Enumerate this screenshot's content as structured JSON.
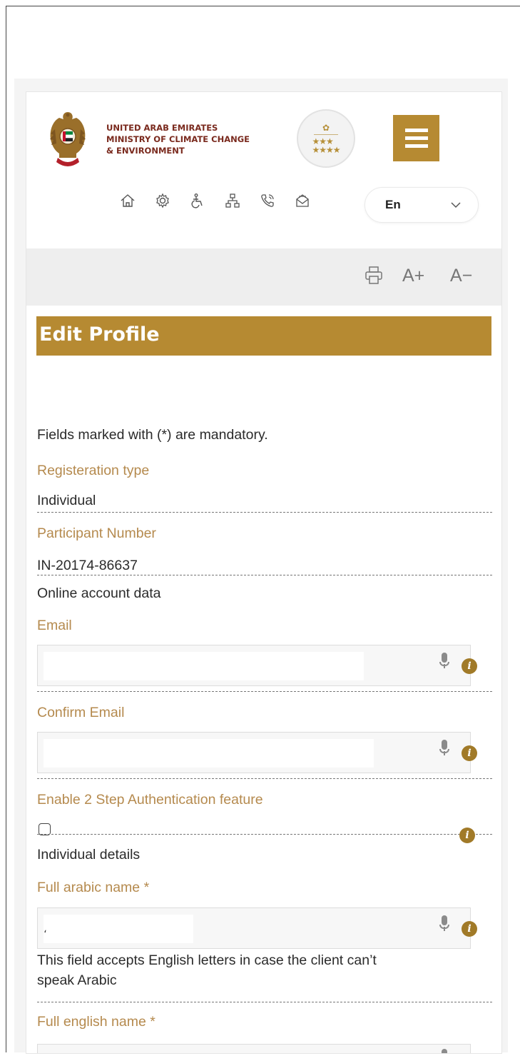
{
  "header": {
    "ministry_lines": [
      "UNITED ARAB EMIRATES",
      "MINISTRY OF CLIMATE CHANGE",
      "& ENVIRONMENT"
    ],
    "menu_icon": "hamburger-icon",
    "badge_icon": "seven-star-rating-badge"
  },
  "utility_icons": [
    "home-icon",
    "settings-icon",
    "accessibility-icon",
    "sitemap-icon",
    "phone-icon",
    "mail-icon"
  ],
  "language": {
    "selected": "En"
  },
  "toolbar": {
    "print_icon": "print-icon",
    "increase_font": "A+",
    "decrease_font": "A−"
  },
  "page": {
    "title": "Edit Profile"
  },
  "form": {
    "mandatory_note": "Fields marked with (*) are mandatory.",
    "registration_type_label": "Registeration type",
    "registration_type_value": "Individual",
    "participant_number_label": "Participant Number",
    "participant_number_value": "IN-20174-86637",
    "online_account_section": "Online account data",
    "email_label": "Email",
    "confirm_email_label": "Confirm Email",
    "two_step_label": "Enable 2 Step Authentication feature",
    "individual_details_section": "Individual details",
    "full_arabic_name_label": "Full arabic name *",
    "full_arabic_name_value": "،",
    "arabic_hint_line1": "This field accepts English letters in case the client can’t",
    "arabic_hint_line2": "speak Arabic",
    "full_english_name_label": "Full english name *",
    "info_glyph": "i"
  }
}
